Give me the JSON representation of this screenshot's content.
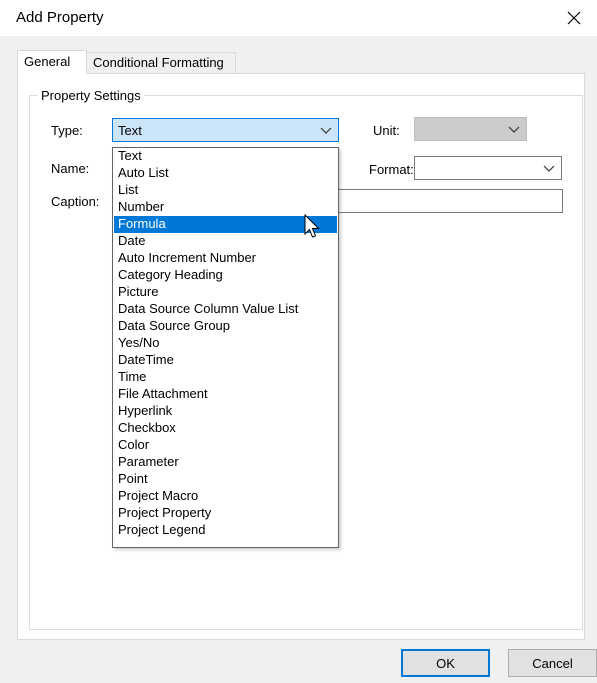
{
  "window": {
    "title": "Add Property"
  },
  "tabs": [
    {
      "label": "General",
      "active": true
    },
    {
      "label": "Conditional Formatting",
      "active": false
    }
  ],
  "group": {
    "legend": "Property Settings"
  },
  "fields": {
    "type": {
      "label": "Type:",
      "value": "Text"
    },
    "unit": {
      "label": "Unit:",
      "value": ""
    },
    "name": {
      "label": "Name:"
    },
    "format": {
      "label": "Format:",
      "value": ""
    },
    "caption": {
      "label": "Caption:",
      "value": ""
    }
  },
  "type_dropdown": {
    "highlighted": "Formula",
    "options": [
      "Text",
      "Auto List",
      "List",
      "Number",
      "Formula",
      "Date",
      "Auto Increment Number",
      "Category Heading",
      "Picture",
      "Data Source Column Value List",
      "Data Source Group",
      "Yes/No",
      "DateTime",
      "Time",
      "File Attachment",
      "Hyperlink",
      "Checkbox",
      "Color",
      "Parameter",
      "Point",
      "Project Macro",
      "Project Property",
      "Project Legend"
    ]
  },
  "buttons": {
    "ok": "OK",
    "cancel": "Cancel"
  },
  "colors": {
    "highlight": "#0078d7",
    "focus_fill": "#cce4f7",
    "disabled_fill": "#cccccc"
  }
}
